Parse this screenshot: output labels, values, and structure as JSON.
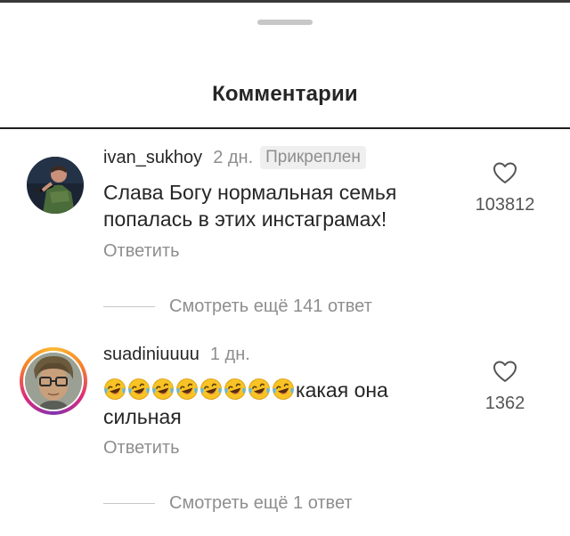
{
  "sheet": {
    "title": "Комментарии"
  },
  "comments": [
    {
      "username": "ivan_sukhoy",
      "time": "2 дн.",
      "pinned": "Прикреплен",
      "text": "Слава Богу нормальная семья попалась в этих инстаграмах!",
      "reply": "Ответить",
      "likes": "103812",
      "view_replies": "Смотреть ещё 141 ответ",
      "avatar_icon": "avatar-photo-singer"
    },
    {
      "username": "suadiniuuuu",
      "time": "1 дн.",
      "emoji_prefix": "😂😂😂😂😂😂😂😂",
      "emoji_count": 8,
      "text": "какая она сильная",
      "reply": "Ответить",
      "likes": "1362",
      "view_replies": "Смотреть ещё 1 ответ",
      "avatar_icon": "avatar-photo-glasses",
      "has_story_ring": true
    }
  ],
  "colors": {
    "text_primary": "#262626",
    "text_secondary": "#8e8e8e",
    "divider": "#1e1e1e",
    "pinned_bg": "#efefef"
  }
}
